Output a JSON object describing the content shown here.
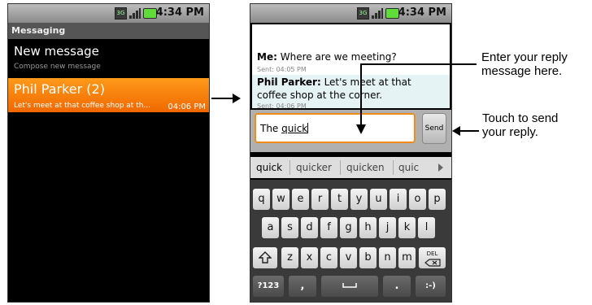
{
  "status": {
    "time": "4:34 PM",
    "network": "3G"
  },
  "list_screen": {
    "title": "Messaging",
    "compose": {
      "title": "New message",
      "subtitle": "Compose new message"
    },
    "thread": {
      "name": "Phil Parker (2)",
      "snippet": "Let's meet at that coffee shop at th...",
      "time": "04:06 PM"
    }
  },
  "conversation": {
    "messages": [
      {
        "sender": "Me:",
        "text": "Where are we meeting?",
        "sent": "Sent: 04:05 PM"
      },
      {
        "sender": "Phil Parker:",
        "text_line1": "Let's meet at that",
        "text_line2": "coffee shop at the corner.",
        "sent": "Sent: 04:06 PM"
      }
    ],
    "input_prefix": "The ",
    "input_word": "quick",
    "send_label": "Send"
  },
  "suggestions": [
    "quick",
    "quicker",
    "quicken",
    "quic"
  ],
  "keyboard": {
    "row1": [
      "q",
      "w",
      "e",
      "r",
      "t",
      "y",
      "u",
      "i",
      "o",
      "p"
    ],
    "row2": [
      "a",
      "s",
      "d",
      "f",
      "g",
      "h",
      "j",
      "k",
      "l"
    ],
    "row3": [
      "z",
      "x",
      "c",
      "v",
      "b",
      "n",
      "m"
    ],
    "del_label": "DEL",
    "sym_label": "?123",
    "comma": ",",
    "period": ".",
    "smiley": ":-)"
  },
  "annotations": {
    "reply_line1": "Enter your reply",
    "reply_line2": "message here.",
    "send_line1": "Touch to send",
    "send_line2": "your reply."
  }
}
